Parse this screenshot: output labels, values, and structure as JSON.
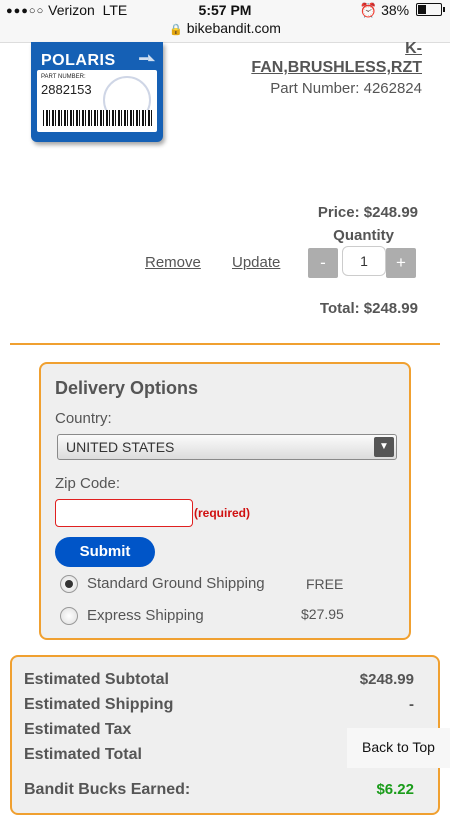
{
  "status_bar": {
    "signal": "●●●○○",
    "carrier": "Verizon",
    "network": "LTE",
    "time": "5:57 PM",
    "alarm": "⏰",
    "battery": "38%",
    "battery_level": 0.38
  },
  "browser": {
    "url": "bikebandit.com"
  },
  "product": {
    "brand_logo_text": "POLARIS",
    "logo_part_label": "PART NUMBER:",
    "logo_part_number": "2882153",
    "name_top": "K-",
    "name": "FAN,BRUSHLESS,RZT",
    "part_number": "Part Number: 4262824"
  },
  "cart": {
    "price": "Price: $248.99",
    "quantity_label": "Quantity",
    "remove_label": "Remove",
    "update_label": "Update",
    "minus_label": "-",
    "plus_label": "+",
    "quantity_value": "1",
    "total": "Total: $248.99"
  },
  "delivery": {
    "title": "Delivery Options",
    "country_label": "Country:",
    "country_value": "UNITED STATES",
    "zip_label": "Zip Code:",
    "zip_value": "",
    "required_label": "(required)",
    "submit_label": "Submit",
    "options": [
      {
        "label": "Standard Ground Shipping",
        "price": "FREE",
        "selected": true
      },
      {
        "label": "Express Shipping",
        "price": "$27.95",
        "selected": false
      }
    ]
  },
  "summary": {
    "rows": [
      {
        "label": "Estimated Subtotal",
        "value": "$248.99"
      },
      {
        "label": "Estimated Shipping",
        "value": "-"
      },
      {
        "label": "Estimated Tax",
        "value": "-"
      },
      {
        "label": "Estimated Total",
        "value": "-"
      },
      {
        "label": "Bandit Bucks Earned:",
        "value": "$6.22"
      }
    ],
    "bucks_color": "#1a9c1a"
  },
  "back_to_top": "Back to Top",
  "colors": {
    "accent_orange": "#f0a030",
    "submit_blue": "#0055c8",
    "required_red": "#d01010"
  }
}
